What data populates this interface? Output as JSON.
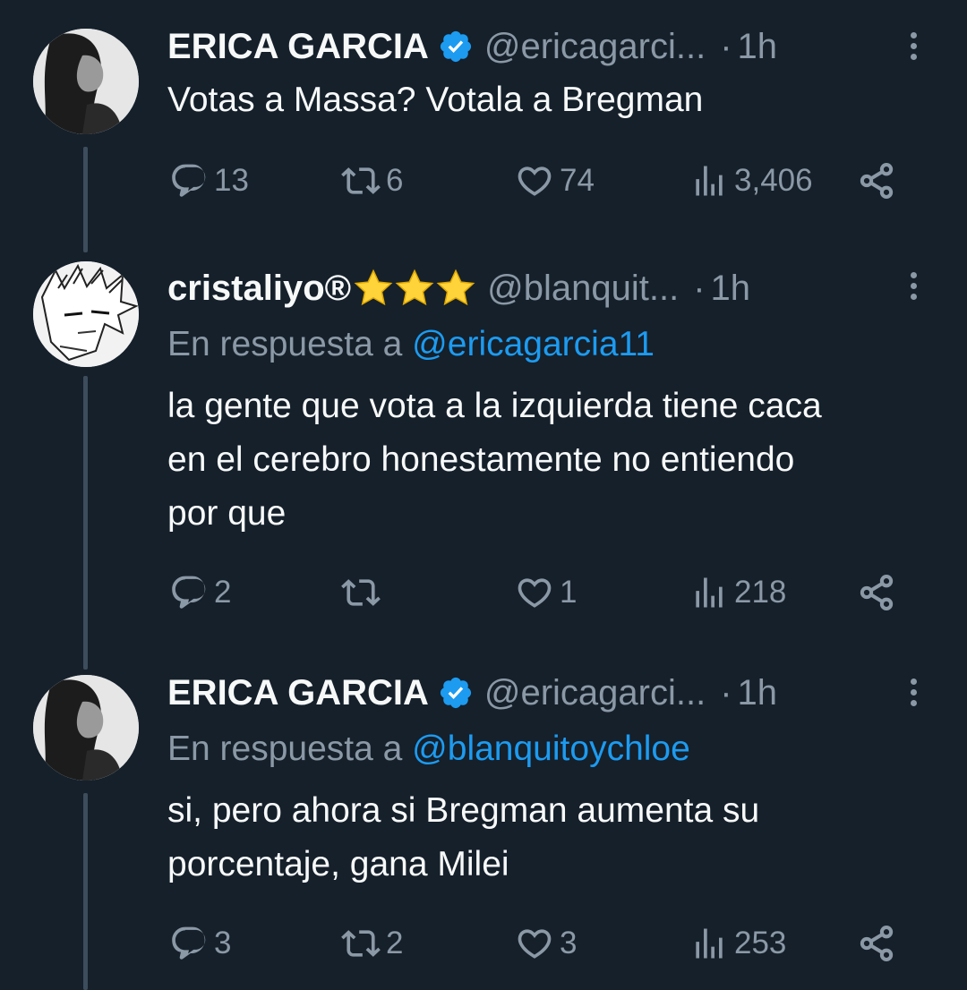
{
  "colors": {
    "background": "#15202b",
    "primary_text": "#f7f9f9",
    "secondary_text": "#8b98a5",
    "link": "#1d9bf0",
    "verified": "#1d9bf0",
    "thread_line": "#3d4d5c",
    "star": "#ffd43b"
  },
  "tweets": [
    {
      "name": "ERICA GARCIA",
      "verified": true,
      "handle": "@ericagarci...",
      "dot": "·",
      "time": "1h",
      "reply_prefix": "",
      "reply_mention": "",
      "text_lines": [
        "Votas a Massa? Votala a Bregman"
      ],
      "replies": "13",
      "retweets": "6",
      "likes": "74",
      "views": "3,406",
      "icons": [
        "reply-icon",
        "retweet-icon",
        "like-icon",
        "views-icon",
        "share-icon"
      ]
    },
    {
      "name": "cristaliyo®",
      "name_emoji": "star-icon x3",
      "verified": false,
      "handle": "@blanquit...",
      "dot": "·",
      "time": "1h",
      "reply_prefix": "En respuesta a ",
      "reply_mention": "@ericagarcia11",
      "text_lines": [
        "la gente que vota a la izquierda tiene caca",
        "en el cerebro honestamente no entiendo",
        "por que"
      ],
      "replies": "2",
      "retweets": "",
      "likes": "1",
      "views": "218"
    },
    {
      "name": "ERICA GARCIA",
      "verified": true,
      "handle": "@ericagarci...",
      "dot": "·",
      "time": "1h",
      "reply_prefix": "En respuesta a ",
      "reply_mention": "@blanquitoychloe",
      "text_lines": [
        "si, pero ahora si Bregman aumenta su",
        "porcentaje, gana Milei"
      ],
      "replies": "3",
      "retweets": "2",
      "likes": "3",
      "views": "253"
    }
  ]
}
